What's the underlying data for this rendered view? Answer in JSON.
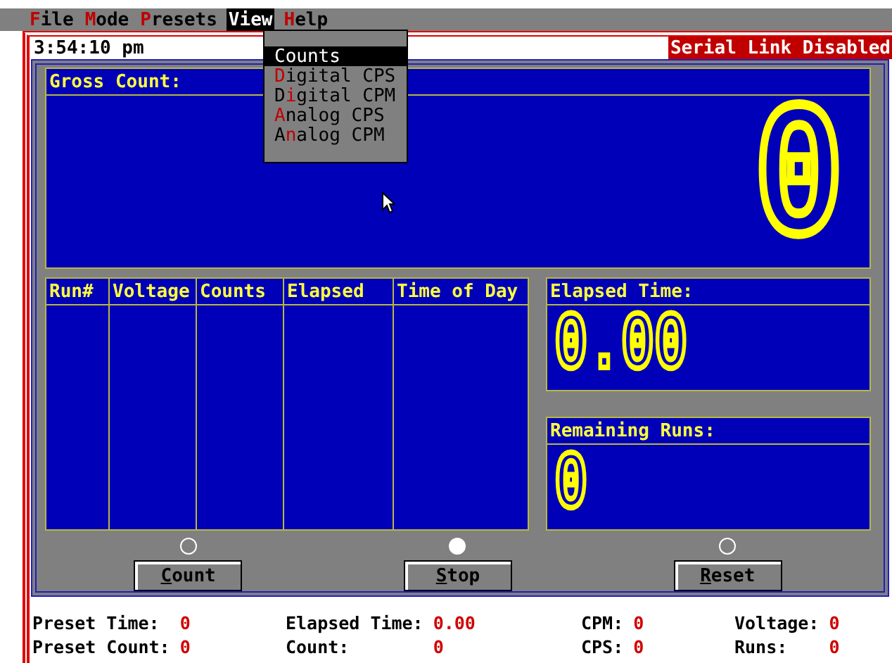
{
  "menu_bar": [
    {
      "key": "F",
      "post": "ile",
      "selected": false
    },
    {
      "key": "M",
      "post": "ode",
      "selected": false
    },
    {
      "key": "P",
      "post": "resets",
      "selected": false
    },
    {
      "key": "V",
      "post": "iew",
      "selected": true
    },
    {
      "key": "H",
      "post": "elp",
      "selected": false
    }
  ],
  "view_menu": [
    {
      "post": "Counts",
      "selected": true
    },
    {
      "key": "D",
      "post": "igital CPS",
      "selected": false
    },
    {
      "pre": "D",
      "key": "i",
      "post": "gital CPM",
      "selected": false
    },
    {
      "key": "A",
      "post": "nalog CPS",
      "selected": false
    },
    {
      "pre": "A",
      "key": "n",
      "post": "alog CPM",
      "selected": false
    }
  ],
  "clock": "3:54:10 pm",
  "serial_link": "Serial Link Disabled",
  "gross_count": {
    "title": "Gross Count:",
    "value": "0"
  },
  "table": {
    "columns": [
      "Run#",
      "Voltage",
      "Counts",
      "Elapsed",
      "Time of Day"
    ]
  },
  "elapsed_time": {
    "title": "Elapsed Time:",
    "value": "0.00"
  },
  "remaining_runs": {
    "title": "Remaining Runs:",
    "value": "0"
  },
  "controls": [
    {
      "key": "C",
      "post": "ount",
      "selected": false
    },
    {
      "key": "S",
      "post": "top",
      "selected": true
    },
    {
      "key": "R",
      "post": "eset",
      "selected": false
    }
  ],
  "status": [
    [
      {
        "label": "Preset Time:",
        "value": "0"
      },
      {
        "label": "Preset Count:",
        "value": "0"
      }
    ],
    [
      {
        "label": "Elapsed Time:",
        "value": "0.00"
      },
      {
        "label": "Count:",
        "value": "0"
      }
    ],
    [
      {
        "label": "CPM:",
        "value": "0"
      },
      {
        "label": "CPS:",
        "value": "0"
      }
    ],
    [
      {
        "label": "Voltage:",
        "value": "0"
      },
      {
        "label": "Runs:",
        "value": "0"
      }
    ]
  ]
}
